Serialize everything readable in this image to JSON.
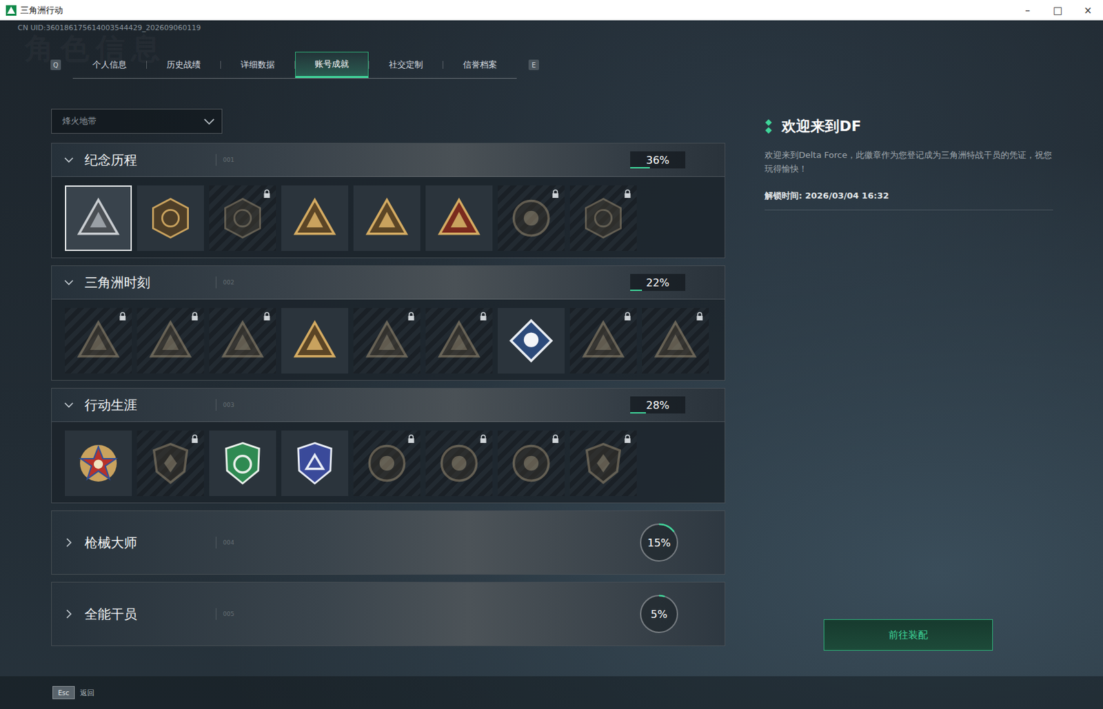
{
  "window": {
    "title": "三角洲行动",
    "controls": [
      "–",
      "□",
      "×"
    ]
  },
  "uid": "CN UID:360186175614003544429_202609060119",
  "watermark": "角色信息",
  "tabs": {
    "prev_key": "Q",
    "next_key": "E",
    "items": [
      {
        "label": "个人信息",
        "selected": false
      },
      {
        "label": "历史战绩",
        "selected": false
      },
      {
        "label": "详细数据",
        "selected": false
      },
      {
        "label": "账号成就",
        "selected": true
      },
      {
        "label": "社交定制",
        "selected": false
      },
      {
        "label": "信誉档案",
        "selected": false
      }
    ]
  },
  "mode_select": {
    "value": "烽火地带",
    "expanded": false
  },
  "sections": [
    {
      "title": "纪念历程",
      "code": "001",
      "percent": "36%",
      "level": 0.36,
      "expanded": true,
      "badges": [
        {
          "locked": false,
          "selected": true
        },
        {
          "locked": false,
          "selected": false
        },
        {
          "locked": true,
          "selected": false
        },
        {
          "locked": false,
          "selected": false
        },
        {
          "locked": false,
          "selected": false
        },
        {
          "locked": false,
          "selected": false
        },
        {
          "locked": true,
          "selected": false
        },
        {
          "locked": true,
          "selected": false
        }
      ]
    },
    {
      "title": "三角洲时刻",
      "code": "002",
      "percent": "22%",
      "level": 0.22,
      "expanded": true,
      "badges": [
        {
          "locked": true,
          "selected": false
        },
        {
          "locked": true,
          "selected": false
        },
        {
          "locked": true,
          "selected": false
        },
        {
          "locked": false,
          "selected": false
        },
        {
          "locked": true,
          "selected": false
        },
        {
          "locked": true,
          "selected": false
        },
        {
          "locked": false,
          "selected": false
        },
        {
          "locked": true,
          "selected": false
        },
        {
          "locked": true,
          "selected": false
        }
      ]
    },
    {
      "title": "行动生涯",
      "code": "003",
      "percent": "28%",
      "level": 0.28,
      "expanded": true,
      "badges": [
        {
          "locked": false,
          "selected": false
        },
        {
          "locked": true,
          "selected": false
        },
        {
          "locked": false,
          "selected": false
        },
        {
          "locked": false,
          "selected": false
        },
        {
          "locked": true,
          "selected": false
        },
        {
          "locked": true,
          "selected": false
        },
        {
          "locked": true,
          "selected": false
        },
        {
          "locked": true,
          "selected": false
        }
      ]
    },
    {
      "title": "枪械大师",
      "code": "004",
      "percent": "15%",
      "level": 0.15,
      "expanded": false,
      "badges": []
    },
    {
      "title": "全能干员",
      "code": "005",
      "percent": "5%",
      "level": 0.05,
      "expanded": false,
      "badges": []
    }
  ],
  "detail": {
    "title": "欢迎来到DF",
    "description": "欢迎来到Delta Force，此徽章作为您登记成为三角洲特战干员的凭证，祝您玩得愉快！",
    "unlock_label": "解锁时间: 2026/03/04 16:32",
    "button": "前往装配"
  },
  "footer": {
    "key": "Esc",
    "label": "返回"
  }
}
